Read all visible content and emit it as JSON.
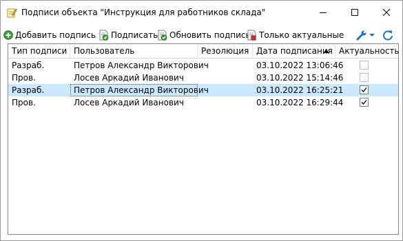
{
  "window": {
    "title": "Подписи объекта \"Инструкция для работников склада\""
  },
  "toolbar": {
    "add_signature": "Добавить подпись",
    "sign": "Подписать",
    "update_signature": "Обновить подпись",
    "only_current": "Только актуальные"
  },
  "table": {
    "columns": [
      "Тип подписи",
      "Пользователь",
      "Резолюция",
      "Дата подписания",
      "Актуальность"
    ],
    "rows": [
      {
        "type": "Разраб.",
        "user": "Петров Александр Викторович",
        "resolution": "",
        "date": "03.10.2022 13:06:46",
        "actual": false
      },
      {
        "type": "Пров.",
        "user": "Лосев Аркадий Иванович",
        "resolution": "",
        "date": "03.10.2022 15:14:46",
        "actual": false
      },
      {
        "type": "Разраб.",
        "user": "Петров Александр Викторович",
        "resolution": "",
        "date": "03.10.2022 16:25:21",
        "actual": true
      },
      {
        "type": "Пров.",
        "user": "Лосев Аркадий Иванович",
        "resolution": "",
        "date": "03.10.2022 16:29:44",
        "actual": true
      }
    ]
  },
  "colors": {
    "selection": "#cce8ff",
    "accent": "#1e72c8"
  }
}
